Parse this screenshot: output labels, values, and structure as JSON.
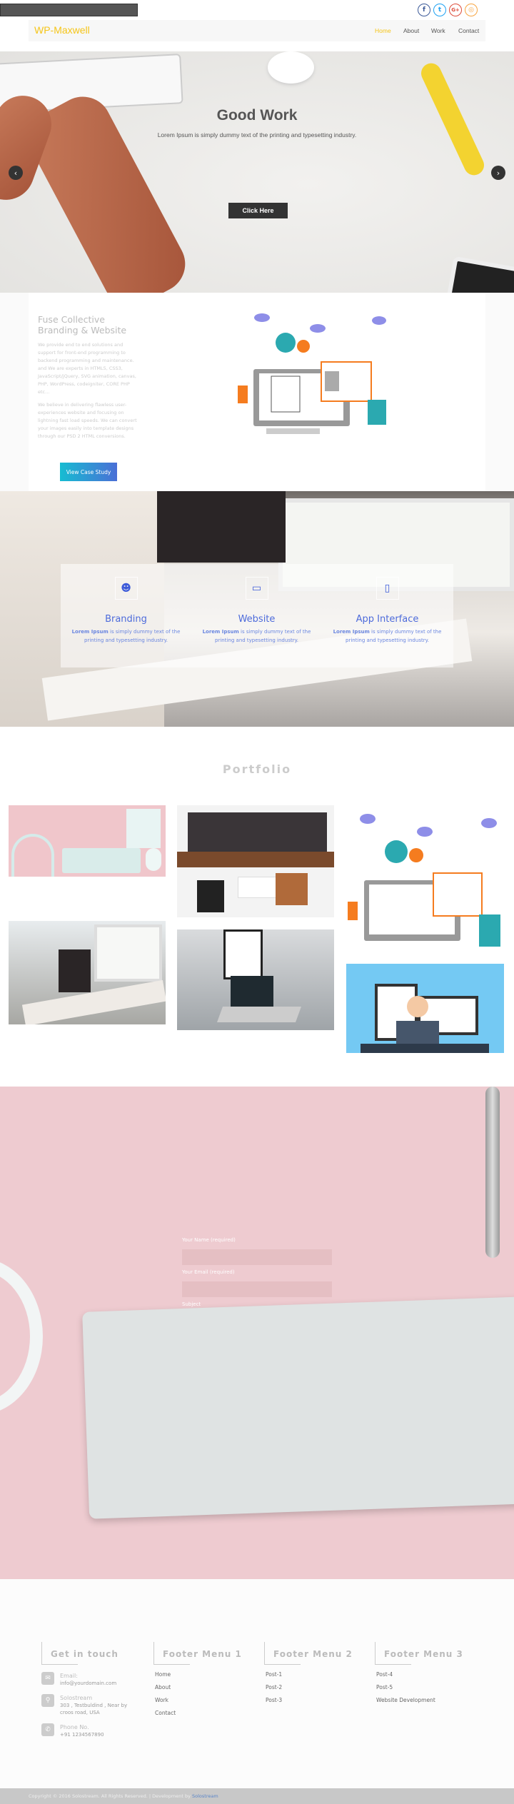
{
  "header": {
    "logo": "WP-Maxwell",
    "nav": [
      "Home",
      "About",
      "Work",
      "Contact"
    ],
    "active": "Home",
    "social": [
      {
        "icon": "facebook-icon",
        "glyph": "f",
        "color": "#3b5998"
      },
      {
        "icon": "twitter-icon",
        "glyph": "t",
        "color": "#1da1f2"
      },
      {
        "icon": "google-plus-icon",
        "glyph": "G+",
        "color": "#dd4b39"
      },
      {
        "icon": "rss-icon",
        "glyph": "◎",
        "color": "#f7a541"
      }
    ]
  },
  "hero": {
    "title": "Good Work",
    "subtitle": "Lorem Ipsum is simply dummy text of the printing and typesetting industry.",
    "button": "Click Here",
    "prev": "‹",
    "next": "›"
  },
  "about": {
    "title": "Fuse Collective Branding & Website",
    "para1": "We provide end to end solutions and support for front-end programming to backend programming and maintenance. and We are experts in HTML5, CSS3, JavaScript/jQuery, SVG animation, canvas, PHP, WordPress, codeigniter, CORE PHP etc...",
    "para2": "We believe in delivering flawless user-experiences website and focusing on lightning fast load speeds. We can convert your images easily into template designs through our PSD 2 HTML conversions.",
    "button": "View Case Study"
  },
  "services": [
    {
      "icon": "branding-icon",
      "glyph": "☻",
      "title": "Branding",
      "bold": "Lorem Ipsum",
      "text": " is simply dummy text of the printing and typesetting industry."
    },
    {
      "icon": "monitor-icon",
      "glyph": "▭",
      "title": "Website",
      "bold": "Lorem Ipsum",
      "text": " is simply dummy text of the printing and typesetting industry."
    },
    {
      "icon": "mobile-icon",
      "glyph": "▯",
      "title": "App Interface",
      "bold": "Lorem Ipsum",
      "text": " is simply dummy text of the printing and typesetting industry."
    }
  ],
  "portfolio": {
    "title": "Portfolio"
  },
  "contact": {
    "name_label": "Your Name (required)",
    "email_label": "Your Email (required)",
    "subject_label": "Subject"
  },
  "footer": {
    "touch": {
      "title": "Get in touch",
      "items": [
        {
          "icon": "envelope-icon",
          "glyph": "✉",
          "title": "Email:",
          "text": "info@yourdomain.com"
        },
        {
          "icon": "map-pin-icon",
          "glyph": "⚲",
          "title": "Solostream",
          "text": "303 , Testbuldind , Near by croos road, USA"
        },
        {
          "icon": "phone-icon",
          "glyph": "✆",
          "title": "Phone No.",
          "text": "+91 1234567890"
        }
      ]
    },
    "menus": [
      {
        "title": "Footer Menu 1",
        "links": [
          "Home",
          "About",
          "Work",
          "Contact"
        ]
      },
      {
        "title": "Footer Menu 2",
        "links": [
          "Post-1",
          "Post-2",
          "Post-3"
        ]
      },
      {
        "title": "Footer Menu 3",
        "links": [
          "Post-4",
          "Post-5",
          "Website Development"
        ]
      }
    ],
    "copyright": "Copyright © 2016 Solostream. All Rights Reserved. | Development by ",
    "dev": "Solostream"
  }
}
